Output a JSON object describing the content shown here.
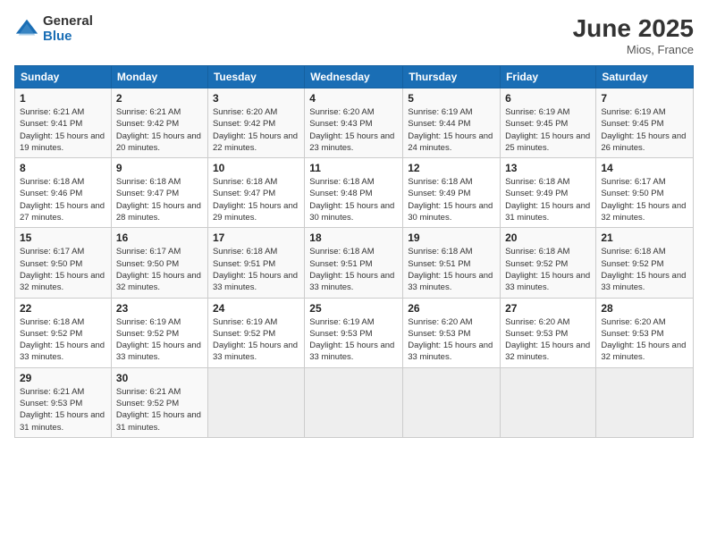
{
  "logo": {
    "general": "General",
    "blue": "Blue"
  },
  "title": {
    "month": "June 2025",
    "location": "Mios, France"
  },
  "days_header": [
    "Sunday",
    "Monday",
    "Tuesday",
    "Wednesday",
    "Thursday",
    "Friday",
    "Saturday"
  ],
  "weeks": [
    [
      {
        "day": "1",
        "sunrise": "6:21 AM",
        "sunset": "9:41 PM",
        "daylight": "15 hours and 19 minutes."
      },
      {
        "day": "2",
        "sunrise": "6:21 AM",
        "sunset": "9:42 PM",
        "daylight": "15 hours and 20 minutes."
      },
      {
        "day": "3",
        "sunrise": "6:20 AM",
        "sunset": "9:42 PM",
        "daylight": "15 hours and 22 minutes."
      },
      {
        "day": "4",
        "sunrise": "6:20 AM",
        "sunset": "9:43 PM",
        "daylight": "15 hours and 23 minutes."
      },
      {
        "day": "5",
        "sunrise": "6:19 AM",
        "sunset": "9:44 PM",
        "daylight": "15 hours and 24 minutes."
      },
      {
        "day": "6",
        "sunrise": "6:19 AM",
        "sunset": "9:45 PM",
        "daylight": "15 hours and 25 minutes."
      },
      {
        "day": "7",
        "sunrise": "6:19 AM",
        "sunset": "9:45 PM",
        "daylight": "15 hours and 26 minutes."
      }
    ],
    [
      {
        "day": "8",
        "sunrise": "6:18 AM",
        "sunset": "9:46 PM",
        "daylight": "15 hours and 27 minutes."
      },
      {
        "day": "9",
        "sunrise": "6:18 AM",
        "sunset": "9:47 PM",
        "daylight": "15 hours and 28 minutes."
      },
      {
        "day": "10",
        "sunrise": "6:18 AM",
        "sunset": "9:47 PM",
        "daylight": "15 hours and 29 minutes."
      },
      {
        "day": "11",
        "sunrise": "6:18 AM",
        "sunset": "9:48 PM",
        "daylight": "15 hours and 30 minutes."
      },
      {
        "day": "12",
        "sunrise": "6:18 AM",
        "sunset": "9:49 PM",
        "daylight": "15 hours and 30 minutes."
      },
      {
        "day": "13",
        "sunrise": "6:18 AM",
        "sunset": "9:49 PM",
        "daylight": "15 hours and 31 minutes."
      },
      {
        "day": "14",
        "sunrise": "6:17 AM",
        "sunset": "9:50 PM",
        "daylight": "15 hours and 32 minutes."
      }
    ],
    [
      {
        "day": "15",
        "sunrise": "6:17 AM",
        "sunset": "9:50 PM",
        "daylight": "15 hours and 32 minutes."
      },
      {
        "day": "16",
        "sunrise": "6:17 AM",
        "sunset": "9:50 PM",
        "daylight": "15 hours and 32 minutes."
      },
      {
        "day": "17",
        "sunrise": "6:18 AM",
        "sunset": "9:51 PM",
        "daylight": "15 hours and 33 minutes."
      },
      {
        "day": "18",
        "sunrise": "6:18 AM",
        "sunset": "9:51 PM",
        "daylight": "15 hours and 33 minutes."
      },
      {
        "day": "19",
        "sunrise": "6:18 AM",
        "sunset": "9:51 PM",
        "daylight": "15 hours and 33 minutes."
      },
      {
        "day": "20",
        "sunrise": "6:18 AM",
        "sunset": "9:52 PM",
        "daylight": "15 hours and 33 minutes."
      },
      {
        "day": "21",
        "sunrise": "6:18 AM",
        "sunset": "9:52 PM",
        "daylight": "15 hours and 33 minutes."
      }
    ],
    [
      {
        "day": "22",
        "sunrise": "6:18 AM",
        "sunset": "9:52 PM",
        "daylight": "15 hours and 33 minutes."
      },
      {
        "day": "23",
        "sunrise": "6:19 AM",
        "sunset": "9:52 PM",
        "daylight": "15 hours and 33 minutes."
      },
      {
        "day": "24",
        "sunrise": "6:19 AM",
        "sunset": "9:52 PM",
        "daylight": "15 hours and 33 minutes."
      },
      {
        "day": "25",
        "sunrise": "6:19 AM",
        "sunset": "9:53 PM",
        "daylight": "15 hours and 33 minutes."
      },
      {
        "day": "26",
        "sunrise": "6:20 AM",
        "sunset": "9:53 PM",
        "daylight": "15 hours and 33 minutes."
      },
      {
        "day": "27",
        "sunrise": "6:20 AM",
        "sunset": "9:53 PM",
        "daylight": "15 hours and 32 minutes."
      },
      {
        "day": "28",
        "sunrise": "6:20 AM",
        "sunset": "9:53 PM",
        "daylight": "15 hours and 32 minutes."
      }
    ],
    [
      {
        "day": "29",
        "sunrise": "6:21 AM",
        "sunset": "9:53 PM",
        "daylight": "15 hours and 31 minutes."
      },
      {
        "day": "30",
        "sunrise": "6:21 AM",
        "sunset": "9:52 PM",
        "daylight": "15 hours and 31 minutes."
      },
      null,
      null,
      null,
      null,
      null
    ]
  ]
}
